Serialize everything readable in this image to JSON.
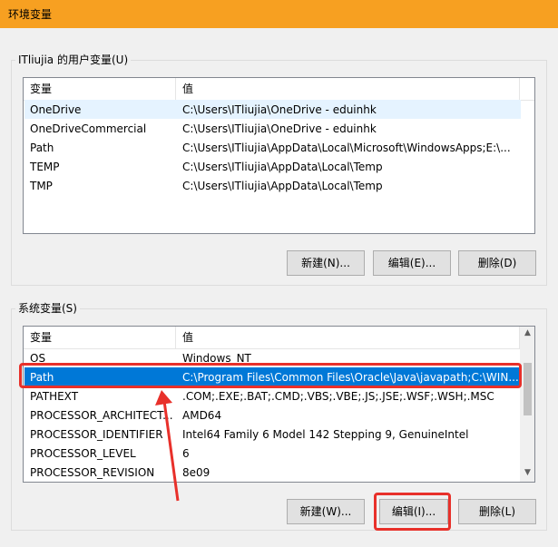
{
  "window": {
    "title": "环境变量"
  },
  "user_vars": {
    "group_label": "ITliujia 的用户变量(U)",
    "columns": [
      "变量",
      "值"
    ],
    "rows": [
      {
        "name": "OneDrive",
        "value": "C:\\Users\\ITliujia\\OneDrive - eduinhk"
      },
      {
        "name": "OneDriveCommercial",
        "value": "C:\\Users\\ITliujia\\OneDrive - eduinhk"
      },
      {
        "name": "Path",
        "value": "C:\\Users\\ITliujia\\AppData\\Local\\Microsoft\\WindowsApps;E:\\..."
      },
      {
        "name": "TEMP",
        "value": "C:\\Users\\ITliujia\\AppData\\Local\\Temp"
      },
      {
        "name": "TMP",
        "value": "C:\\Users\\ITliujia\\AppData\\Local\\Temp"
      }
    ],
    "buttons": {
      "new": "新建(N)...",
      "edit": "编辑(E)...",
      "delete": "删除(D)"
    }
  },
  "system_vars": {
    "group_label": "系统变量(S)",
    "columns": [
      "变量",
      "值"
    ],
    "rows": [
      {
        "name": "OS",
        "value": "Windows_NT"
      },
      {
        "name": "Path",
        "value": "C:\\Program Files\\Common Files\\Oracle\\Java\\javapath;C:\\WIN...",
        "selected": true
      },
      {
        "name": "PATHEXT",
        "value": ".COM;.EXE;.BAT;.CMD;.VBS;.VBE;.JS;.JSE;.WSF;.WSH;.MSC"
      },
      {
        "name": "PROCESSOR_ARCHITECT...",
        "value": "AMD64"
      },
      {
        "name": "PROCESSOR_IDENTIFIER",
        "value": "Intel64 Family 6 Model 142 Stepping 9, GenuineIntel"
      },
      {
        "name": "PROCESSOR_LEVEL",
        "value": "6"
      },
      {
        "name": "PROCESSOR_REVISION",
        "value": "8e09"
      }
    ],
    "buttons": {
      "new": "新建(W)...",
      "edit": "编辑(I)...",
      "delete": "删除(L)"
    }
  },
  "colors": {
    "titlebar": "#f7a021",
    "selection": "#0078d7",
    "annotation": "#e8302a"
  },
  "icons": {
    "scroll_up": "chevron-up-icon",
    "scroll_down": "chevron-down-icon"
  }
}
